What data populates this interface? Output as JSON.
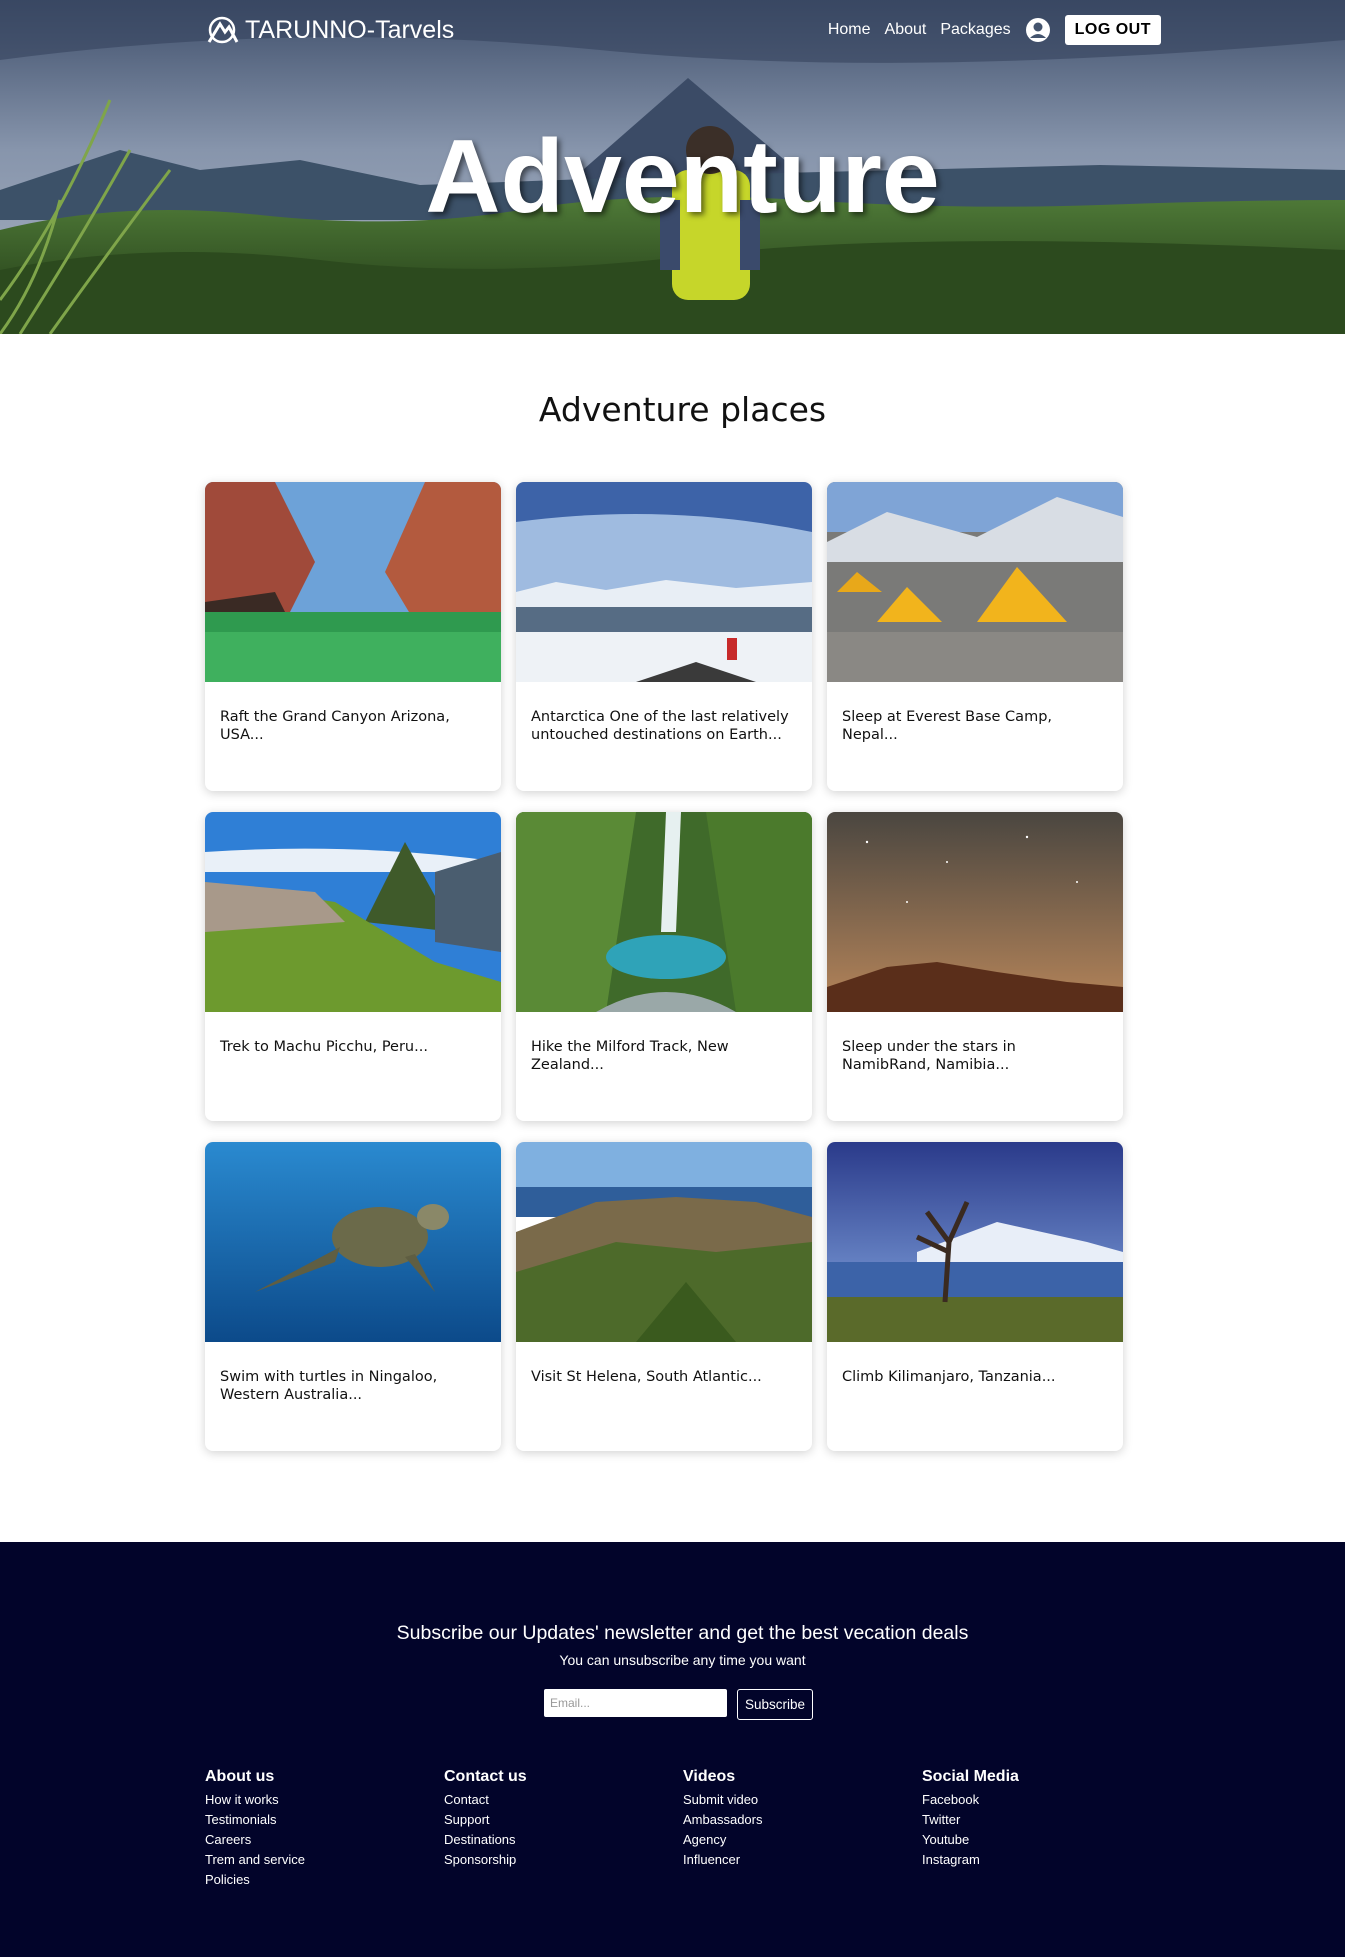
{
  "nav": {
    "brand": "TARUNNO-Tarvels",
    "links": [
      "Home",
      "About",
      "Packages"
    ],
    "logout": "LOG OUT"
  },
  "hero": {
    "title": "Adventure"
  },
  "section": {
    "title": "Adventure places"
  },
  "cards": [
    {
      "text": "Raft the Grand Canyon Arizona, USA..."
    },
    {
      "text": "Antarctica One of the last relatively untouched destinations on Earth..."
    },
    {
      "text": "Sleep at Everest Base Camp, Nepal..."
    },
    {
      "text": "Trek to Machu Picchu, Peru..."
    },
    {
      "text": "Hike the Milford Track, New Zealand..."
    },
    {
      "text": "Sleep under the stars in NamibRand, Namibia..."
    },
    {
      "text": "Swim with turtles in Ningaloo, Western Australia..."
    },
    {
      "text": "Visit St Helena, South Atlantic..."
    },
    {
      "text": "Climb Kilimanjaro, Tanzania..."
    }
  ],
  "footer": {
    "subscribe_title": "Subscribe our Updates' newsletter and get the best vecation deals",
    "subscribe_note": "You can unsubscribe any time you want",
    "email_placeholder": "Email...",
    "subscribe_button": "Subscribe",
    "columns": [
      {
        "title": "About us",
        "links": [
          "How it works",
          "Testimonials",
          "Careers",
          "Trem and service",
          "Policies"
        ]
      },
      {
        "title": "Contact us",
        "links": [
          "Contact",
          "Support",
          "Destinations",
          "Sponsorship"
        ]
      },
      {
        "title": "Videos",
        "links": [
          "Submit video",
          "Ambassadors",
          "Agency",
          "Influencer"
        ]
      },
      {
        "title": "Social Media",
        "links": [
          "Facebook",
          "Twitter",
          "Youtube",
          "Instagram"
        ]
      }
    ]
  }
}
